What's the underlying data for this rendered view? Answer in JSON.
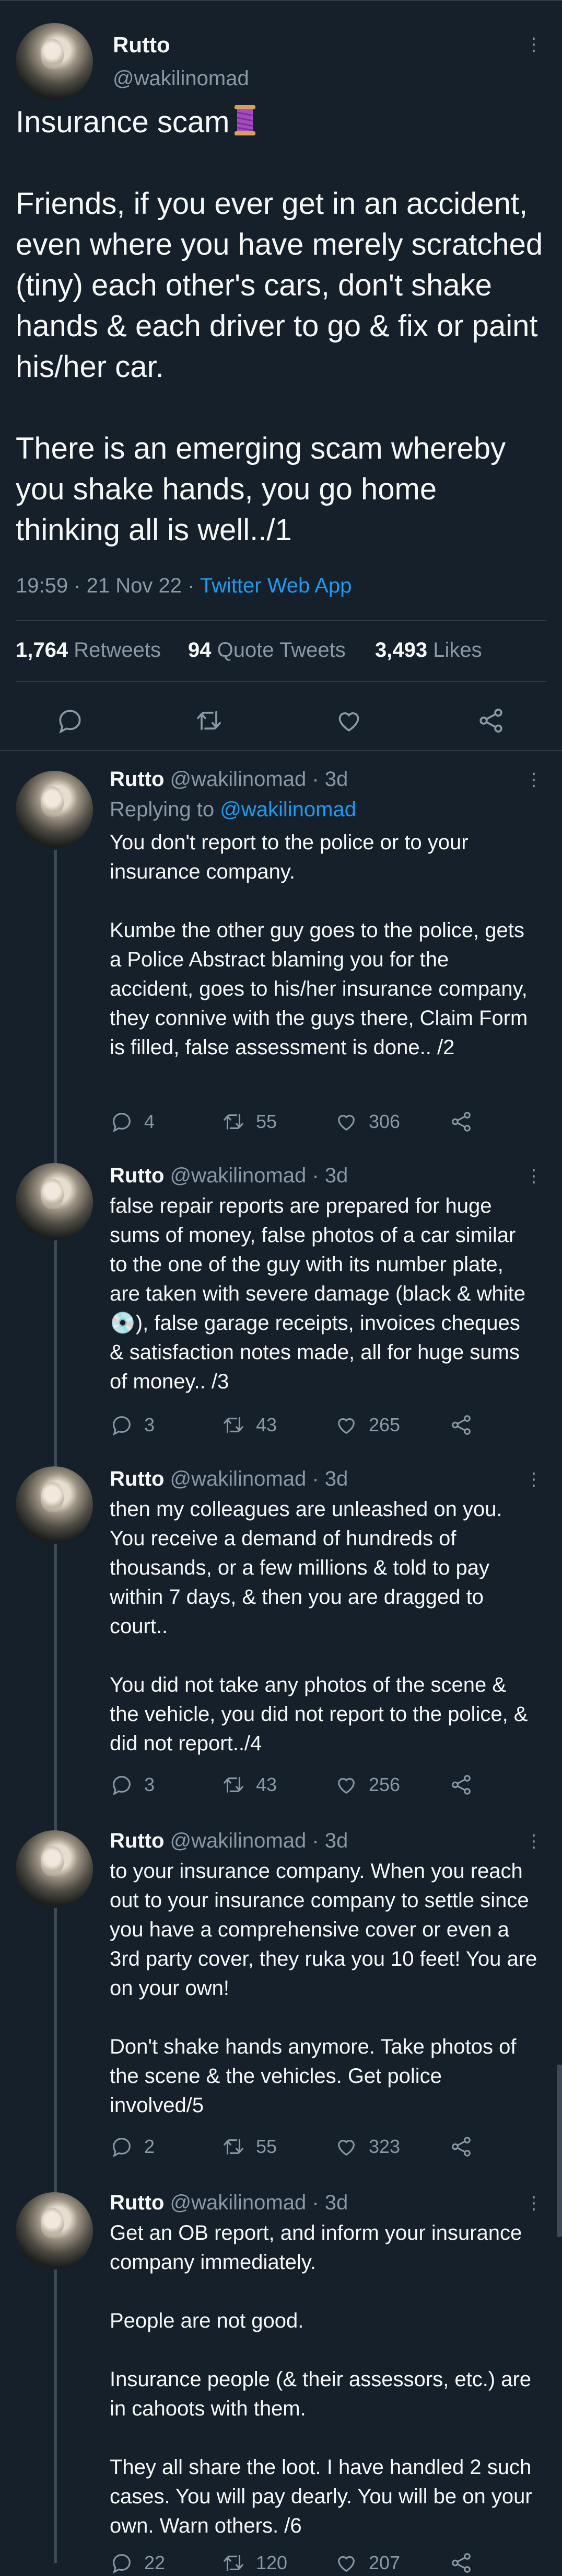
{
  "main_tweet": {
    "author_name": "Rutto",
    "handle": "@wakilinomad",
    "title": "Insurance scam",
    "paragraph1": "Friends, if you ever get in an accident, even where you have merely scratched (tiny) each other's cars, don't shake hands & each driver to go & fix or paint his/her car.",
    "paragraph2": "There is an emerging scam whereby you shake hands, you go home thinking all is well../1",
    "time": "19:59 · 21 Nov 22 · ",
    "source": "Twitter Web App",
    "retweets_count": "1,764",
    "retweets_label": "Retweets",
    "quotes_count": "94",
    "quotes_label": "Quote Tweets",
    "likes_count": "3,493",
    "likes_label": "Likes"
  },
  "replies": [
    {
      "name": "Rutto",
      "meta": "@wakilinomad · 3d",
      "replying_prefix": "Replying to ",
      "replying_handle": "@wakilinomad",
      "text": "You don't report to the police or to your insurance company.\n\nKumbe the other guy goes to the police, gets a Police Abstract blaming you for the accident, goes to his/her insurance company, they connive with the guys there, Claim Form is filled, false assessment is done.. /2",
      "replies": "4",
      "retweets": "55",
      "likes": "306"
    },
    {
      "name": "Rutto",
      "meta": "@wakilinomad · 3d",
      "text": "false repair reports are prepared for huge sums of money, false photos of a car similar to the one of the guy with its number plate, are taken with severe damage (black & white💿), false garage receipts, invoices cheques & satisfaction notes made, all for huge sums of money.. /3",
      "replies": "3",
      "retweets": "43",
      "likes": "265"
    },
    {
      "name": "Rutto",
      "meta": "@wakilinomad · 3d",
      "text": "then my colleagues are unleashed on you. You receive a demand of hundreds of thousands, or a few millions & told to pay within 7 days, & then you are dragged to court..\n\nYou did not take any photos of the scene & the vehicle, you did not report to the police, & did not report../4",
      "replies": "3",
      "retweets": "43",
      "likes": "256"
    },
    {
      "name": "Rutto",
      "meta": "@wakilinomad · 3d",
      "text": "to your insurance company. When you reach out to your insurance company to settle since you have a comprehensive cover or even a 3rd party cover, they ruka you 10 feet! You are on your own!\n\nDon't shake hands anymore. Take photos of the scene & the vehicles. Get police involved/5",
      "replies": "2",
      "retweets": "55",
      "likes": "323"
    },
    {
      "name": "Rutto",
      "meta": "@wakilinomad · 3d",
      "text": "Get an OB report, and inform your insurance company immediately.\n\nPeople are not good.\n\nInsurance people (& their assessors, etc.) are in cahoots with them.\n\nThey all share the loot. I have handled 2 such cases. You will pay dearly. You will be on your own. Warn others. /6",
      "replies": "22",
      "retweets": "120",
      "likes": "207"
    }
  ],
  "colors": {
    "background": "#15202b",
    "text": "#f7f9f9",
    "muted": "#8b98a5",
    "link": "#1d9bf0",
    "divider": "#2f3b47"
  },
  "icons": [
    "more-icon",
    "spool-emoji-icon",
    "reply-icon",
    "retweet-icon",
    "like-icon",
    "share-icon"
  ]
}
